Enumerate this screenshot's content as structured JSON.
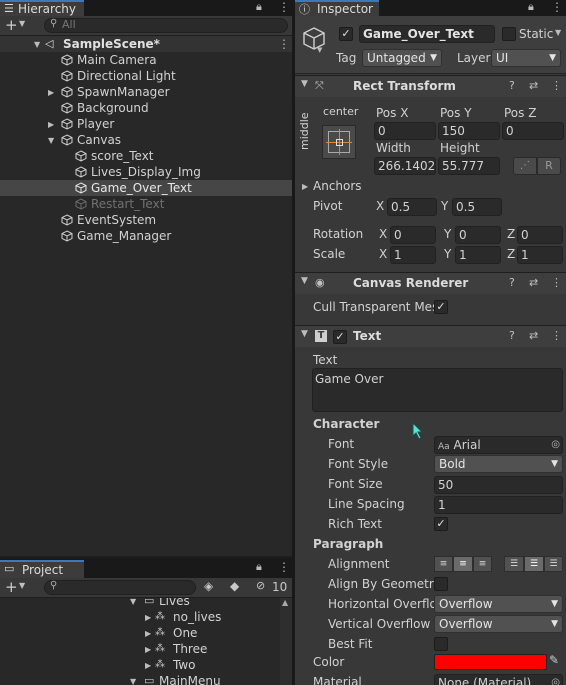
{
  "hierarchy": {
    "tab_label": "Hierarchy",
    "search_placeholder": "All",
    "scene_name": "SampleScene*",
    "items": [
      {
        "label": "Main Camera"
      },
      {
        "label": "Directional Light"
      },
      {
        "label": "SpawnManager"
      },
      {
        "label": "Background"
      },
      {
        "label": "Player"
      },
      {
        "label": "Canvas"
      },
      {
        "label": "score_Text"
      },
      {
        "label": "Lives_Display_Img"
      },
      {
        "label": "Game_Over_Text"
      },
      {
        "label": "Restart_Text"
      },
      {
        "label": "EventSystem"
      },
      {
        "label": "Game_Manager"
      }
    ]
  },
  "project": {
    "tab_label": "Project",
    "hidden_count": "10",
    "items": [
      {
        "label": "Lives"
      },
      {
        "label": "no_lives"
      },
      {
        "label": "One"
      },
      {
        "label": "Three"
      },
      {
        "label": "Two"
      },
      {
        "label": "MainMenu"
      }
    ]
  },
  "inspector": {
    "tab_label": "Inspector",
    "object_name": "Game_Over_Text",
    "static_label": "Static",
    "tag_label": "Tag",
    "tag_value": "Untagged",
    "layer_label": "Layer",
    "layer_value": "UI",
    "rect_transform": {
      "title": "Rect Transform",
      "anchor_h": "center",
      "anchor_v": "middle",
      "pos_x_label": "Pos X",
      "pos_x": "0",
      "pos_y_label": "Pos Y",
      "pos_y": "150",
      "pos_z_label": "Pos Z",
      "pos_z": "0",
      "width_label": "Width",
      "width": "266.1402",
      "height_label": "Height",
      "height": "55.777",
      "raw_label": "R",
      "anchors_label": "Anchors",
      "pivot_label": "Pivot",
      "pivot_x": "0.5",
      "pivot_y": "0.5",
      "rotation_label": "Rotation",
      "rot_x": "0",
      "rot_y": "0",
      "rot_z": "0",
      "scale_label": "Scale",
      "scale_x": "1",
      "scale_y": "1",
      "scale_z": "1",
      "x": "X",
      "y": "Y",
      "z": "Z"
    },
    "canvas_renderer": {
      "title": "Canvas Renderer",
      "cull_label": "Cull Transparent Mes"
    },
    "text": {
      "title": "Text",
      "text_label": "Text",
      "text_value": "Game Over",
      "character_label": "Character",
      "font_label": "Font",
      "font_value": "Arial",
      "font_style_label": "Font Style",
      "font_style_value": "Bold",
      "font_size_label": "Font Size",
      "font_size_value": "50",
      "line_spacing_label": "Line Spacing",
      "line_spacing_value": "1",
      "rich_text_label": "Rich Text",
      "paragraph_label": "Paragraph",
      "alignment_label": "Alignment",
      "align_geometry_label": "Align By Geometry",
      "h_overflow_label": "Horizontal Overflo",
      "h_overflow_value": "Overflow",
      "v_overflow_label": "Vertical Overflow",
      "v_overflow_value": "Overflow",
      "best_fit_label": "Best Fit",
      "color_label": "Color",
      "color_value": "#ff0000",
      "material_label": "Material",
      "material_value": "None (Material)"
    }
  }
}
